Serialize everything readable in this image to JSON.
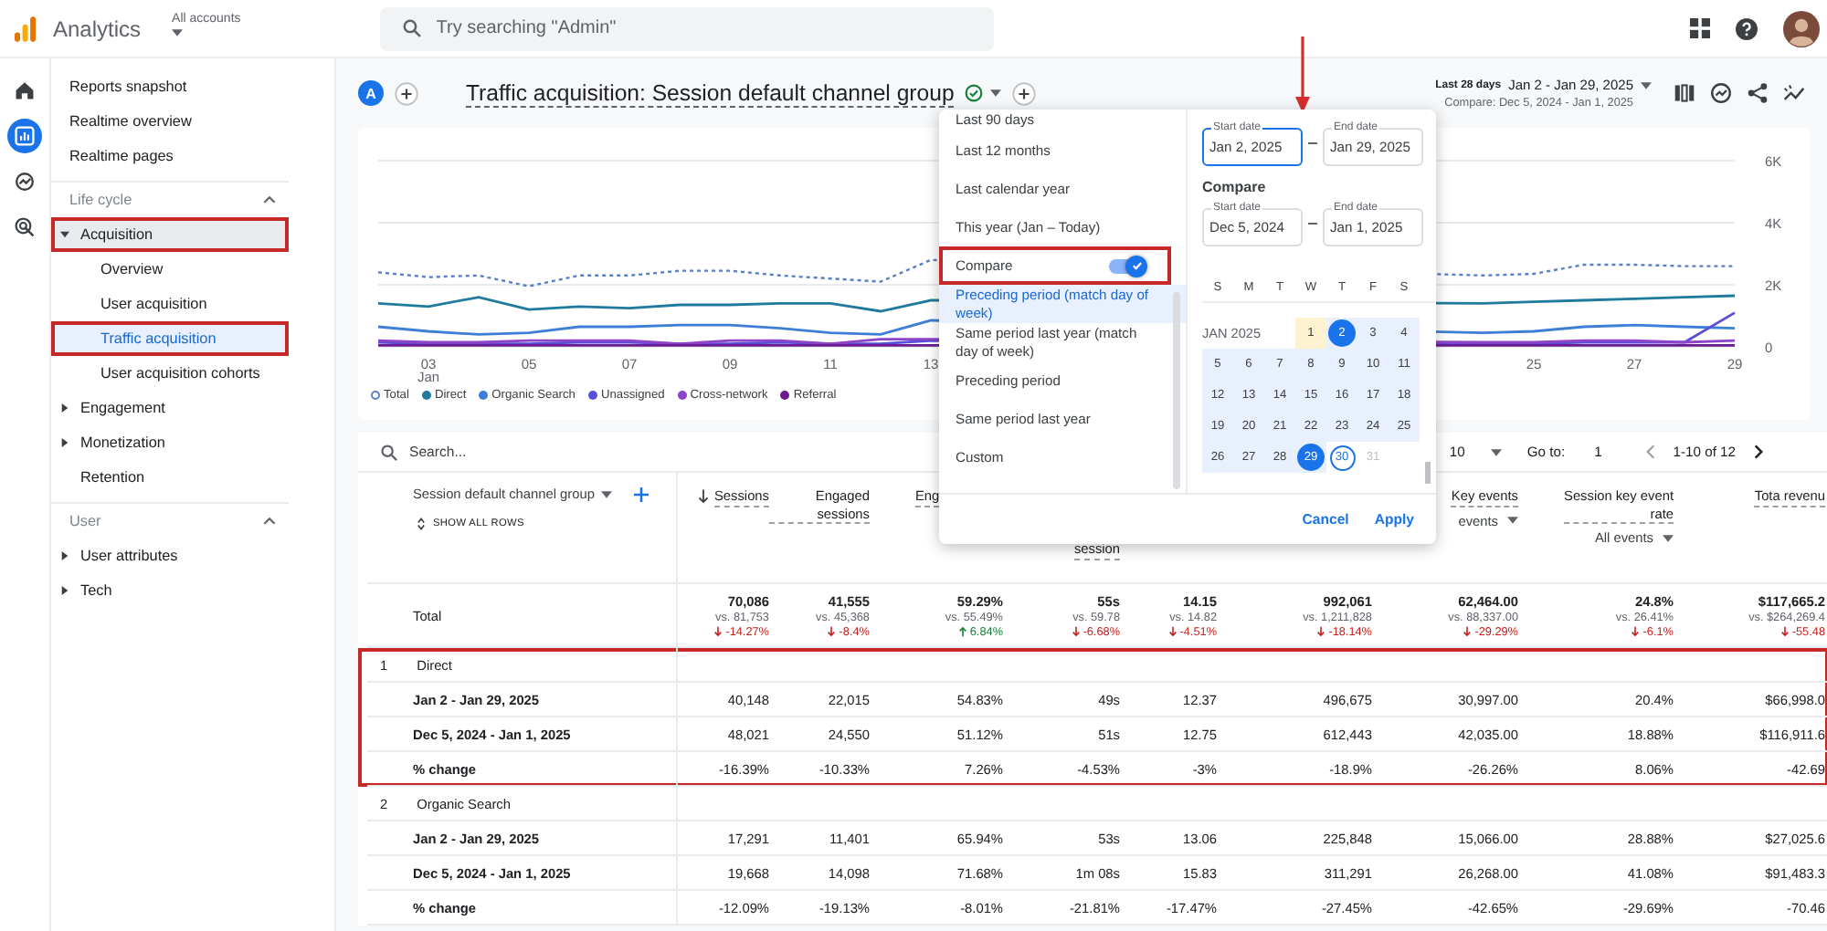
{
  "topbar": {
    "product": "Analytics",
    "account": "All accounts",
    "search": {
      "placeholder": "Try searching \"Admin\""
    }
  },
  "rail": [
    {
      "kind": "home",
      "selected": false
    },
    {
      "kind": "reports",
      "selected": true
    },
    {
      "kind": "explore",
      "selected": false
    },
    {
      "kind": "advertising",
      "selected": false
    }
  ],
  "sidebar": {
    "top_items": [
      {
        "label": "Reports snapshot"
      },
      {
        "label": "Realtime overview"
      },
      {
        "label": "Realtime pages"
      }
    ],
    "sections": [
      {
        "title": "Life cycle",
        "expanded": true,
        "items": [
          {
            "label": "Acquisition",
            "kind": "group",
            "expanded": true,
            "selected": true,
            "highlighted": true,
            "children": [
              {
                "label": "Overview",
                "selected": false,
                "highlighted": false
              },
              {
                "label": "User acquisition",
                "selected": false,
                "highlighted": false
              },
              {
                "label": "Traffic acquisition",
                "selected": true,
                "highlighted": true
              },
              {
                "label": "User acquisition cohorts",
                "selected": false,
                "highlighted": false
              }
            ]
          },
          {
            "label": "Engagement",
            "kind": "group",
            "expanded": false,
            "selected": false,
            "highlighted": false
          },
          {
            "label": "Monetization",
            "kind": "group",
            "expanded": false,
            "selected": false,
            "highlighted": false
          },
          {
            "label": "Retention",
            "kind": "link",
            "selected": false,
            "highlighted": false
          }
        ]
      },
      {
        "title": "User",
        "expanded": true,
        "items": [
          {
            "label": "User attributes",
            "kind": "group",
            "expanded": false,
            "selected": false,
            "highlighted": false
          },
          {
            "label": "Tech",
            "kind": "group",
            "expanded": false,
            "selected": false,
            "highlighted": false
          }
        ]
      }
    ]
  },
  "header": {
    "property_badge": "A",
    "title": "Traffic acquisition: Session default channel group",
    "period_label": "Last 28 days",
    "period": "Jan 2 - Jan 29, 2025",
    "compare": "Compare: Dec 5, 2024 - Jan 1, 2025"
  },
  "chart": {
    "chart_data": {
      "type": "line",
      "x": [
        2,
        3,
        4,
        5,
        6,
        7,
        8,
        9,
        10,
        11,
        12,
        13,
        24,
        25,
        26,
        27,
        28,
        29
      ],
      "xlim": [
        2,
        29
      ],
      "xticks": [
        {
          "value": 3,
          "label": "03 Jan"
        },
        {
          "value": 5,
          "label": "05"
        },
        {
          "value": 7,
          "label": "07"
        },
        {
          "value": 9,
          "label": "09"
        },
        {
          "value": 11,
          "label": "11"
        },
        {
          "value": 13,
          "label": "13"
        },
        {
          "value": 25,
          "label": "25"
        },
        {
          "value": 27,
          "label": "27"
        },
        {
          "value": 29,
          "label": "29"
        }
      ],
      "ylim": [
        0,
        6000
      ],
      "yticks": [
        {
          "value": 0,
          "label": "0"
        },
        {
          "value": 2000,
          "label": "2K"
        },
        {
          "value": 4000,
          "label": "4K"
        },
        {
          "value": 6000,
          "label": "6K"
        }
      ],
      "series": [
        {
          "name": "Total",
          "color": "#5b7fc4",
          "line_style": "dotted",
          "values": [
            2400,
            2250,
            2300,
            1950,
            2300,
            2300,
            2450,
            2450,
            2300,
            2200,
            2100,
            2800,
            2300,
            2350,
            2650,
            2650,
            2600,
            2600
          ]
        },
        {
          "name": "Direct",
          "color": "#1f7a9e",
          "line_style": "solid",
          "values": [
            1400,
            1300,
            1600,
            1200,
            1300,
            1250,
            1350,
            1350,
            1400,
            1400,
            1150,
            1500,
            1400,
            1450,
            1500,
            1550,
            1600,
            1650
          ]
        },
        {
          "name": "Organic Search",
          "color": "#3d7fd6",
          "line_style": "solid",
          "values": [
            650,
            500,
            400,
            450,
            650,
            650,
            700,
            700,
            600,
            450,
            400,
            850,
            450,
            500,
            650,
            700,
            650,
            600
          ]
        },
        {
          "name": "Unassigned",
          "color": "#5a4fd8",
          "line_style": "solid",
          "values": [
            150,
            100,
            100,
            100,
            150,
            150,
            100,
            100,
            150,
            100,
            100,
            200,
            100,
            100,
            150,
            150,
            150,
            1100
          ]
        },
        {
          "name": "Cross-network",
          "color": "#8e44c9",
          "line_style": "solid",
          "values": [
            200,
            150,
            150,
            200,
            200,
            200,
            100,
            200,
            200,
            100,
            250,
            250,
            150,
            150,
            200,
            200,
            150,
            200
          ]
        },
        {
          "name": "Referral",
          "color": "#6a1b8f",
          "line_style": "solid",
          "values": [
            50,
            50,
            50,
            50,
            50,
            50,
            50,
            50,
            50,
            50,
            50,
            50,
            50,
            50,
            50,
            50,
            50,
            50
          ]
        }
      ]
    }
  },
  "table": {
    "search": {
      "placeholder": "Search..."
    },
    "rows_per_page": "10",
    "goto_label": "Go to:",
    "goto_value": "1",
    "range": "1-10 of 12",
    "dimension": "Session default channel group",
    "show_all": "SHOW ALL ROWS",
    "columns": [
      {
        "label": "Sessions",
        "sorted": true,
        "cut_right": false,
        "cut_top": false
      },
      {
        "label": "Engaged sessions",
        "sorted": false,
        "cut_right": false,
        "cut_top": false
      },
      {
        "label": "Eng",
        "sorted": false,
        "cut_right": true,
        "cut_top": false
      },
      {
        "label": "session",
        "sorted": false,
        "cut_right": false,
        "cut_top": true
      },
      {},
      {},
      {
        "label": "Key events",
        "sorted": false,
        "cut_right": false,
        "cut_top": false,
        "filter": "events"
      },
      {
        "label": "Session key event rate",
        "sorted": false,
        "cut_right": false,
        "cut_top": false,
        "filter": "All events"
      },
      {
        "label": "Tota revenu",
        "sorted": false,
        "cut_right": false,
        "cut_top": false
      }
    ],
    "total": {
      "label": "Total",
      "cells": [
        {
          "value": "70,086",
          "vs": "vs. 81,753",
          "change": "-14.27%",
          "kind": "decrease"
        },
        {
          "value": "41,555",
          "vs": "vs. 45,368",
          "change": "-8.4%",
          "kind": "decrease"
        },
        {
          "value": "59.29%",
          "vs": "vs. 55.49%",
          "change": "6.84%",
          "kind": "increase"
        },
        {
          "value": "55s",
          "vs": "vs. 59.78",
          "change": "-6.68%",
          "kind": "decrease"
        },
        {
          "value": "14.15",
          "vs": "vs. 14.82",
          "change": "-4.51%",
          "kind": "decrease"
        },
        {
          "value": "992,061",
          "vs": "vs. 1,211,828",
          "change": "-18.14%",
          "kind": "decrease"
        },
        {
          "value": "62,464.00",
          "vs": "vs. 88,337.00",
          "change": "-29.29%",
          "kind": "decrease"
        },
        {
          "value": "24.8%",
          "vs": "vs. 26.41%",
          "change": "-6.1%",
          "kind": "decrease"
        },
        {
          "value": "$117,665.2",
          "vs": "vs. $264,269.4",
          "change": "-55.48",
          "kind": "decrease"
        }
      ]
    },
    "groups": [
      {
        "number": "1",
        "name": "Direct",
        "highlighted": true,
        "rows": [
          {
            "label": "Jan 2 - Jan 29, 2025",
            "values": [
              "40,148",
              "22,015",
              "54.83%",
              "49s",
              "12.37",
              "496,675",
              "30,997.00",
              "20.4%",
              "$66,998.0"
            ]
          },
          {
            "label": "Dec 5, 2024 - Jan 1, 2025",
            "values": [
              "48,021",
              "24,550",
              "51.12%",
              "51s",
              "12.75",
              "612,443",
              "42,035.00",
              "18.88%",
              "$116,911.6"
            ]
          },
          {
            "label": "% change",
            "values": [
              "-16.39%",
              "-10.33%",
              "7.26%",
              "-4.53%",
              "-3%",
              "-18.9%",
              "-26.26%",
              "8.06%",
              "-42.69"
            ]
          }
        ]
      },
      {
        "number": "2",
        "name": "Organic Search",
        "highlighted": false,
        "rows": [
          {
            "label": "Jan 2 - Jan 29, 2025",
            "values": [
              "17,291",
              "11,401",
              "65.94%",
              "53s",
              "13.06",
              "225,848",
              "15,066.00",
              "28.88%",
              "$27,025.6"
            ]
          },
          {
            "label": "Dec 5, 2024 - Jan 1, 2025",
            "values": [
              "19,668",
              "14,098",
              "71.68%",
              "1m 08s",
              "15.83",
              "311,291",
              "26,268.00",
              "41.08%",
              "$91,483.3"
            ]
          },
          {
            "label": "% change",
            "values": [
              "-12.09%",
              "-19.13%",
              "-8.01%",
              "-21.81%",
              "-17.47%",
              "-27.45%",
              "-42.65%",
              "-29.69%",
              "-70.46"
            ]
          }
        ]
      }
    ]
  },
  "date_picker": {
    "presets": [
      {
        "label": "Last 90 days",
        "selected": false
      },
      {
        "label": "Last 12 months",
        "selected": false
      },
      {
        "label": "Last calendar year",
        "selected": false
      },
      {
        "label": "This year (Jan – Today)",
        "selected": false
      }
    ],
    "compare_toggle": {
      "label": "Compare",
      "on": true,
      "highlighted": true
    },
    "compare_options": [
      {
        "label": "Preceding period (match day of week)",
        "selected": true
      },
      {
        "label": "Same period last year (match day of week)",
        "selected": false
      },
      {
        "label": "Preceding period",
        "selected": false
      },
      {
        "label": "Same period last year",
        "selected": false
      },
      {
        "label": "Custom",
        "selected": false
      }
    ],
    "range": {
      "start_label": "Start date",
      "start": "Jan 2, 2025",
      "start_focused": true,
      "end_label": "End date",
      "end": "Jan 29, 2025",
      "end_focused": false
    },
    "compare_heading": "Compare",
    "compare_range": {
      "start_label": "Start date",
      "start": "Dec 5, 2024",
      "start_focused": false,
      "end_label": "End date",
      "end": "Jan 1, 2025",
      "end_focused": false
    },
    "weekdays": [
      "S",
      "M",
      "T",
      "W",
      "T",
      "F",
      "S"
    ],
    "month": "JAN 2025",
    "days": [
      {
        "day": "1",
        "kind": "compare"
      },
      {
        "day": "2",
        "kind": "start"
      },
      {
        "day": "3",
        "kind": "range"
      },
      {
        "day": "4",
        "kind": "range"
      },
      {
        "day": "5",
        "kind": "range"
      },
      {
        "day": "6",
        "kind": "range"
      },
      {
        "day": "7",
        "kind": "range"
      },
      {
        "day": "8",
        "kind": "range"
      },
      {
        "day": "9",
        "kind": "range"
      },
      {
        "day": "10",
        "kind": "range"
      },
      {
        "day": "11",
        "kind": "range"
      },
      {
        "day": "12",
        "kind": "range"
      },
      {
        "day": "13",
        "kind": "range"
      },
      {
        "day": "14",
        "kind": "range"
      },
      {
        "day": "15",
        "kind": "range"
      },
      {
        "day": "16",
        "kind": "range"
      },
      {
        "day": "17",
        "kind": "range"
      },
      {
        "day": "18",
        "kind": "range"
      },
      {
        "day": "19",
        "kind": "range"
      },
      {
        "day": "20",
        "kind": "range"
      },
      {
        "day": "21",
        "kind": "range"
      },
      {
        "day": "22",
        "kind": "range"
      },
      {
        "day": "23",
        "kind": "range"
      },
      {
        "day": "24",
        "kind": "range"
      },
      {
        "day": "25",
        "kind": "range"
      },
      {
        "day": "26",
        "kind": "range"
      },
      {
        "day": "27",
        "kind": "range"
      },
      {
        "day": "28",
        "kind": "range"
      },
      {
        "day": "29",
        "kind": "end"
      },
      {
        "day": "30",
        "kind": "today"
      },
      {
        "day": "31",
        "kind": "disabled"
      }
    ],
    "buttons": [
      "Cancel",
      "Apply"
    ]
  }
}
